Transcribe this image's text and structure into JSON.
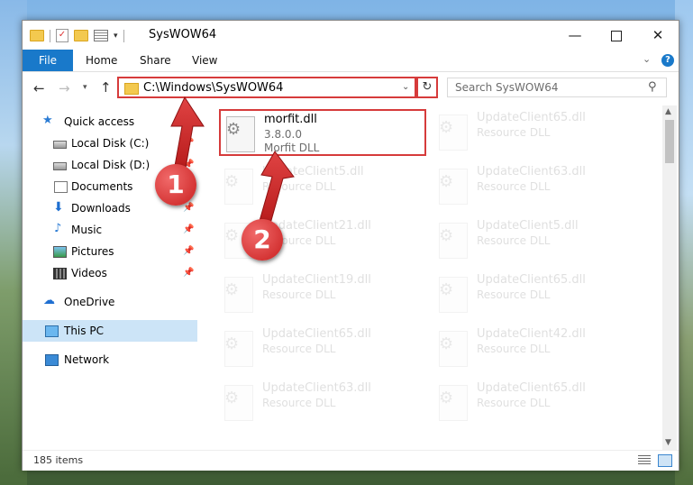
{
  "window": {
    "title": "SysWOW64"
  },
  "titlebar": {
    "minimize": "—",
    "close": "✕"
  },
  "ribbon": {
    "tabs": [
      "File",
      "Home",
      "Share",
      "View"
    ],
    "help": "?"
  },
  "address": {
    "path": "C:\\Windows\\SysWOW64",
    "refresh": "↻"
  },
  "search": {
    "placeholder": "Search SysWOW64",
    "icon": "search-icon"
  },
  "nav": {
    "items": [
      {
        "label": "Quick access",
        "icon": "star-icon",
        "pinned": false
      },
      {
        "label": "Local Disk (C:)",
        "icon": "disk-icon",
        "pinned": true
      },
      {
        "label": "Local Disk (D:)",
        "icon": "disk-icon",
        "pinned": true
      },
      {
        "label": "Documents",
        "icon": "documents-icon",
        "pinned": true
      },
      {
        "label": "Downloads",
        "icon": "download-icon",
        "pinned": true
      },
      {
        "label": "Music",
        "icon": "music-icon",
        "pinned": true
      },
      {
        "label": "Pictures",
        "icon": "pictures-icon",
        "pinned": true
      },
      {
        "label": "Videos",
        "icon": "videos-icon",
        "pinned": true
      },
      {
        "label": "OneDrive",
        "icon": "cloud-icon",
        "pinned": false
      },
      {
        "label": "This PC",
        "icon": "computer-icon",
        "pinned": false
      },
      {
        "label": "Network",
        "icon": "network-icon",
        "pinned": false
      }
    ]
  },
  "files": [
    {
      "name": "morfit.dll",
      "line1": "3.8.0.0",
      "line2": "Morfit DLL"
    },
    {
      "name": "UpdateClient65.dll",
      "line1": "Resource DLL"
    },
    {
      "name": "UpdateClient5.dll",
      "line1": "Resource DLL"
    },
    {
      "name": "UpdateClient63.dll",
      "line1": "Resource DLL"
    },
    {
      "name": "UpdateClient21.dll",
      "line1": "Resource DLL"
    },
    {
      "name": "UpdateClient5.dll",
      "line1": "Resource DLL"
    },
    {
      "name": "UpdateClient19.dll",
      "line1": "Resource DLL"
    },
    {
      "name": "UpdateClient65.dll",
      "line1": "Resource DLL"
    },
    {
      "name": "UpdateClient65.dll",
      "line1": "Resource DLL"
    },
    {
      "name": "UpdateClient42.dll",
      "line1": "Resource DLL"
    },
    {
      "name": "UpdateClient63.dll",
      "line1": "Resource DLL"
    },
    {
      "name": "UpdateClient65.dll",
      "line1": "Resource DLL"
    }
  ],
  "status": {
    "items": "185 items"
  },
  "callouts": {
    "one": "1",
    "two": "2"
  },
  "colors": {
    "accent": "#1979ca",
    "highlight": "#d63b3b",
    "selected": "#cce4f7"
  }
}
